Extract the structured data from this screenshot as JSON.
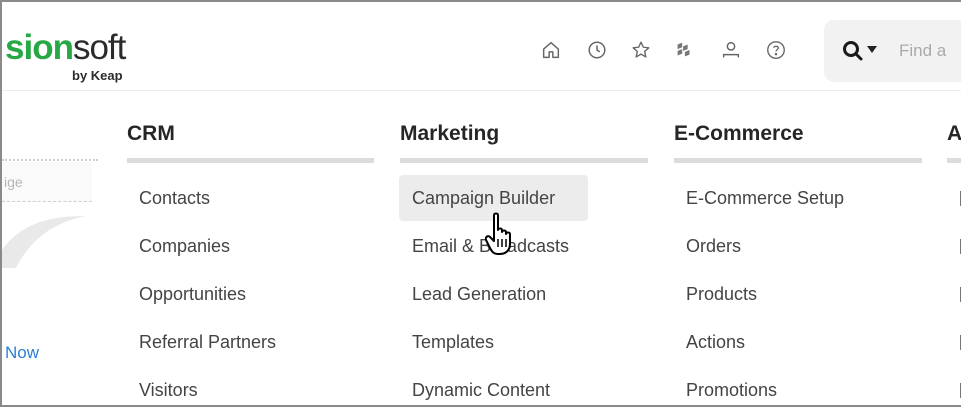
{
  "header": {
    "logo_text_green": "sion",
    "logo_text_dark": "soft",
    "logo_sub": "by Keap",
    "icons": [
      "home-icon",
      "clock-icon",
      "star-icon",
      "puzzle-icon",
      "person-icon",
      "help-icon"
    ],
    "search": {
      "placeholder": "Find a",
      "icon": "search-icon"
    }
  },
  "left": {
    "input_placeholder": "ige",
    "link_label": "Now"
  },
  "columns": [
    {
      "heading": "CRM",
      "items": [
        "Contacts",
        "Companies",
        "Opportunities",
        "Referral Partners",
        "Visitors"
      ]
    },
    {
      "heading": "Marketing",
      "items": [
        "Campaign Builder",
        "Email & Broadcasts",
        "Lead Generation",
        "Templates",
        "Dynamic Content"
      ],
      "hovered_index": 0
    },
    {
      "heading": "E-Commerce",
      "items": [
        "E-Commerce Setup",
        "Orders",
        "Products",
        "Actions",
        "Promotions"
      ]
    },
    {
      "heading": "A",
      "items": []
    }
  ],
  "colors": {
    "brand_green": "#28a745",
    "link_blue": "#2a7fd4",
    "hover_bg": "#ececec",
    "rule": "#dcdcdc"
  }
}
